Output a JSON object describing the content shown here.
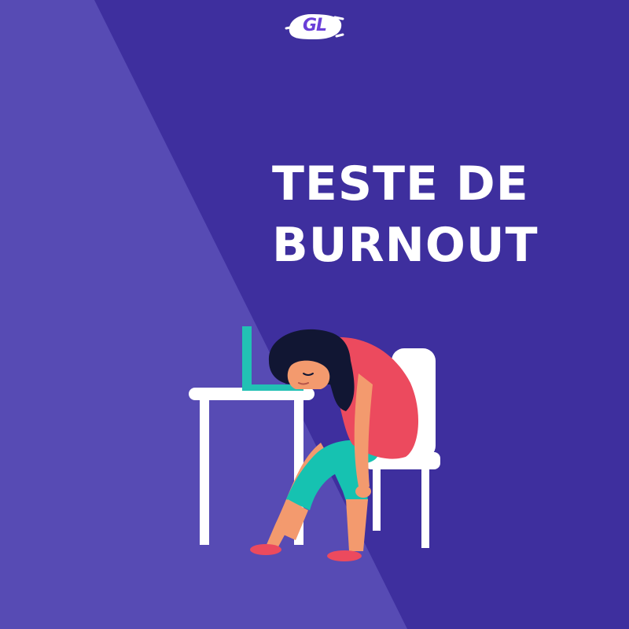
{
  "logo": {
    "text": "GL"
  },
  "headline": {
    "line1": "TESTE DE",
    "line2": "BURNOUT"
  },
  "colors": {
    "background_dark": "#3e2f9e",
    "background_light": "#574bb4",
    "text": "#ffffff",
    "logo_accent": "#6a3fd8",
    "laptop": "#22c1b4",
    "shirt": "#ec4a5e",
    "pants": "#16c2b1",
    "skin": "#f39a6e",
    "hair": "#111633"
  },
  "illustration": {
    "icon": "burnout-woman-desk-illustration"
  }
}
